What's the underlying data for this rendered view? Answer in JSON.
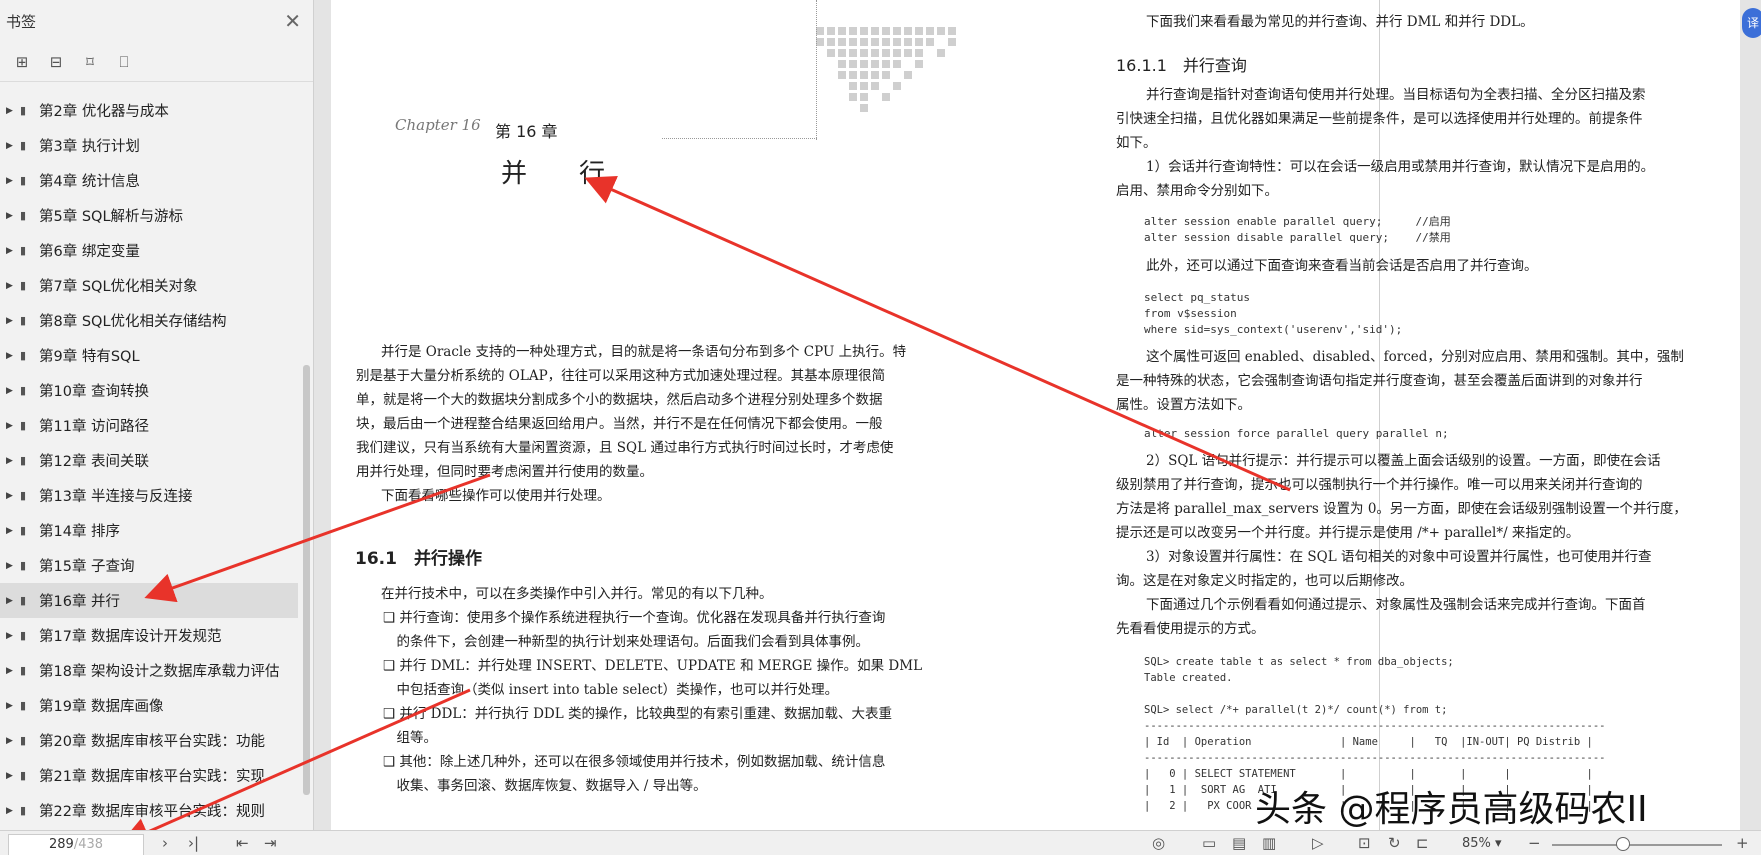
{
  "sidebar": {
    "title": "书签",
    "bookmarks": [
      "第2章 优化器与成本",
      "第3章 执行计划",
      "第4章 统计信息",
      "第5章 SQL解析与游标",
      "第6章 绑定变量",
      "第7章 SQL优化相关对象",
      "第8章 SQL优化相关存储结构",
      "第9章 特有SQL",
      "第10章 查询转换",
      "第11章 访问路径",
      "第12章 表间关联",
      "第13章 半连接与反连接",
      "第14章 排序",
      "第15章 子查询",
      "第16章 并行",
      "第17章 数据库设计开发规范",
      "第18章 架构设计之数据库承载力评估",
      "第19章 数据库画像",
      "第20章 数据库审核平台实践：功能",
      "第21章 数据库审核平台实践：实现",
      "第22章 数据库审核平台实践：规则"
    ],
    "selected_index": 14
  },
  "left_page": {
    "chapter_script": "Chapter 16",
    "chapter_num": "第 16 章",
    "chapter_title": "并　　行",
    "intro": [
      "并行是 Oracle 支持的一种处理方式，目的就是将一条语句分布到多个 CPU 上执行。特",
      "别是基于大量分析系统的 OLAP，往往可以采用这种方式加速处理过程。其基本原理很简",
      "单，就是将一个大的数据块分割成多个小的数据块，然后启动多个进程分别处理多个数据",
      "块，最后由一个进程整合结果返回给用户。当然，并行不是在任何情况下都会使用。一般",
      "我们建议，只有当系统有大量闲置资源，且 SQL 通过串行方式执行时间过长时，才考虑使",
      "用并行处理，但同时要考虑闲置并行使用的数量。",
      "下面看看哪些操作可以使用并行处理。"
    ],
    "section_title": "16.1　并行操作",
    "section_lines": [
      "在并行技术中，可以在多类操作中引入并行。常见的有以下几种。",
      "❑ 并行查询：使用多个操作系统进程执行一个查询。优化器在发现具备并行执行查询",
      "　的条件下，会创建一种新型的执行计划来处理语句。后面我们会看到具体事例。",
      "❑ 并行 DML：并行处理 INSERT、DELETE、UPDATE 和 MERGE 操作。如果 DML",
      "　中包括查询（类似 insert into table select）类操作，也可以并行处理。",
      "❑ 并行 DDL：并行执行 DDL 类的操作，比较典型的有索引重建、数据加载、大表重",
      "　组等。",
      "❑ 其他：除上述几种外，还可以在很多领域使用并行技术，例如数据加载、统计信息",
      "　收集、事务回滚、数据库恢复、数据导入 / 导出等。"
    ]
  },
  "right_page": {
    "top_line": "下面我们来看看最为常见的并行查询、并行 DML 和并行 DDL。",
    "subsection_title": "16.1.1　并行查询",
    "p1": [
      "并行查询是指针对查询语句使用并行处理。当目标语句为全表扫描、全分区扫描及索",
      "引快速全扫描，且优化器如果满足一些前提条件，是可以选择使用并行处理的。前提条件",
      "如下。",
      "1）会话并行查询特性：可以在会话一级启用或禁用并行查询，默认情况下是启用的。",
      "启用、禁用命令分别如下。"
    ],
    "code1": "alter session enable parallel query;     //启用\nalter session disable parallel query;    //禁用",
    "p2": "此外，还可以通过下面查询来查看当前会话是否启用了并行查询。",
    "code2": "select pq_status\nfrom v$session\nwhere sid=sys_context('userenv','sid');",
    "p3": [
      "这个属性可返回 enabled、disabled、forced，分别对应启用、禁用和强制。其中，强制",
      "是一种特殊的状态，它会强制查询语句指定并行度查询，甚至会覆盖后面讲到的对象并行",
      "属性。设置方法如下。"
    ],
    "code3": "alter session force parallel query parallel n;",
    "p4": [
      "2）SQL 语句并行提示：并行提示可以覆盖上面会话级别的设置。一方面，即使在会话",
      "级别禁用了并行查询，提示也可以强制执行一个并行操作。唯一可以用来关闭并行查询的",
      "方法是将 parallel_max_servers 设置为 0。另一方面，即使在会话级别强制设置一个并行度，",
      "提示还是可以改变另一个并行度。并行提示是使用 /*+ parallel*/ 来指定的。",
      "3）对象设置并行属性：在 SQL 语句相关的对象中可设置并行属性，也可使用并行查",
      "询。这是在对象定义时指定的，也可以后期修改。",
      "下面通过几个示例看看如何通过提示、对象属性及强制会话来完成并行查询。下面首",
      "先看看使用提示的方式。"
    ],
    "code4": "SQL> create table t as select * from dba_objects;\nTable created.\n\nSQL> select /*+ parallel(t 2)*/ count(*) from t;\n-------------------------------------------------------------------------\n| Id  | Operation              | Name     |   TQ  |IN-OUT| PQ Distrib |\n-------------------------------------------------------------------------\n|   0 | SELECT STATEMENT       |          |       |      |            |\n|   1 |  SORT AG  ATI          |          |       |      |            |\n|   2 |   PX COOR              |          |       |      |            |"
  },
  "statusbar": {
    "page_current": "289",
    "page_total": "/438",
    "zoom": "85%"
  },
  "watermark": "头条 @程序员高级码农II"
}
